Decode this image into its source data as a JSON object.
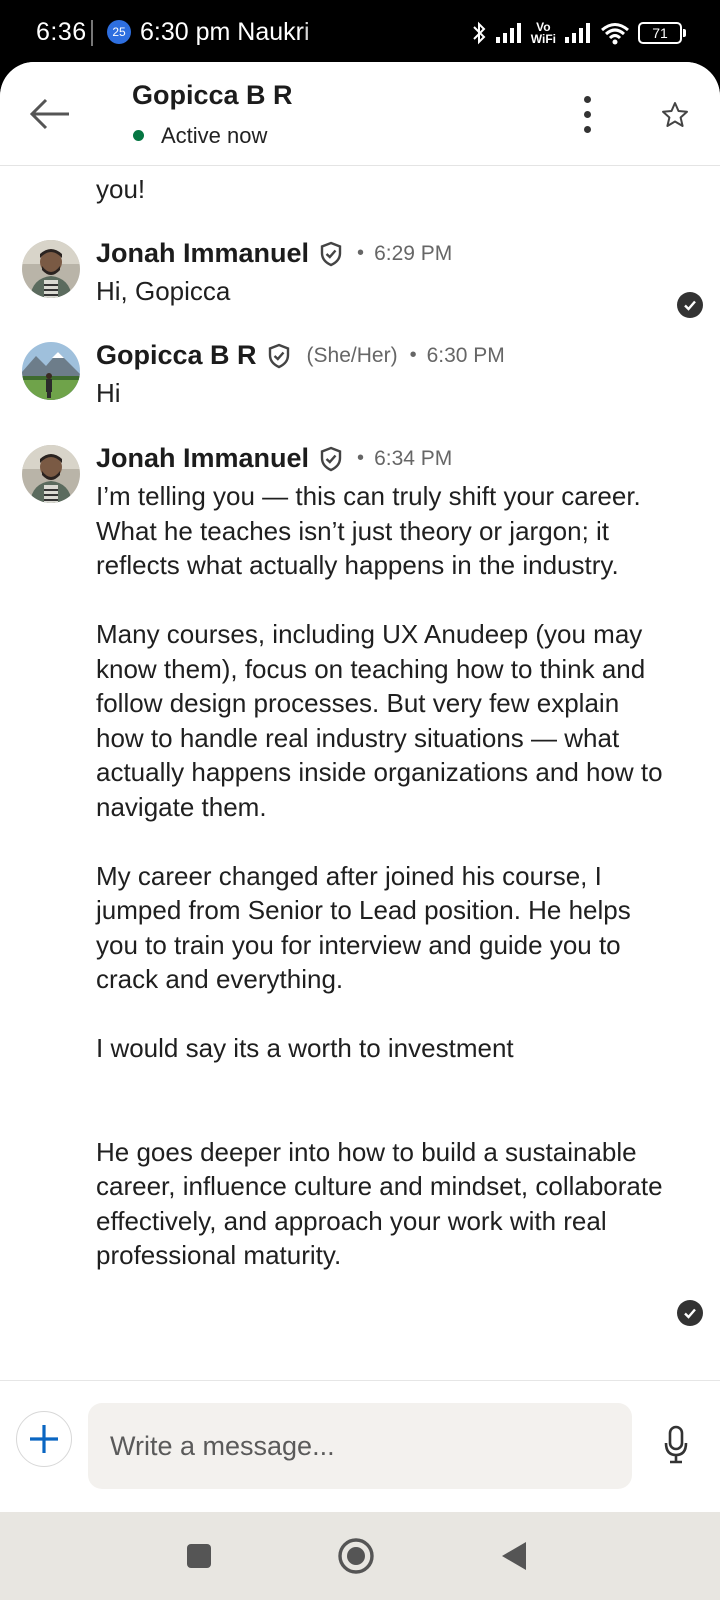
{
  "status_bar": {
    "time": "6:36",
    "badge": "25",
    "notification": "6:30 pm Naukri",
    "vowifi_top": "Vo",
    "vowifi_bottom": "WiFi",
    "battery": "71"
  },
  "header": {
    "contact_name": "Gopicca B R",
    "status": "Active now",
    "status_color": "#057642"
  },
  "messages": {
    "partial_top_tail": "you!",
    "items": [
      {
        "sender": "Jonah Immanuel",
        "pronoun": "",
        "time": "6:29 PM",
        "paragraphs": [
          "Hi, Gopicca"
        ]
      },
      {
        "sender": "Gopicca B R",
        "pronoun": "(She/Her)",
        "time": "6:30 PM",
        "paragraphs": [
          "Hi"
        ]
      },
      {
        "sender": "Jonah Immanuel",
        "pronoun": "",
        "time": "6:34 PM",
        "paragraphs": [
          "I’m telling you — this can truly shift your career. What he teaches isn’t just theory or jargon; it reflects what actually happens in the industry.",
          "Many courses, including UX Anudeep (you may know them), focus on teaching how to think and follow design processes. But very few explain how to handle real industry situations — what actually happens inside organizations and how to navigate them.",
          "My career changed after joined his course, I jumped from Senior to Lead position. He helps you to train you for interview and guide you to crack and everything.",
          "I would say its a worth to investment",
          "He goes deeper into how to build a sustainable career, influence culture and mindset, collaborate effectively, and approach your work with real professional maturity."
        ]
      }
    ],
    "separator": "•"
  },
  "composer": {
    "placeholder": "Write a message...",
    "value": ""
  },
  "icons": {
    "back": "back-arrow-icon",
    "more": "more-vertical-icon",
    "star": "star-icon",
    "add": "plus-icon",
    "mic": "microphone-icon",
    "verified": "verified-shield-icon",
    "read": "read-receipt-check-icon",
    "nav_recents": "square-icon",
    "nav_home": "circle-home-icon",
    "nav_back": "triangle-back-icon"
  },
  "colors": {
    "accent": "#0a66c2",
    "active_green": "#057642",
    "navbar_bg": "#e8e6e1"
  }
}
